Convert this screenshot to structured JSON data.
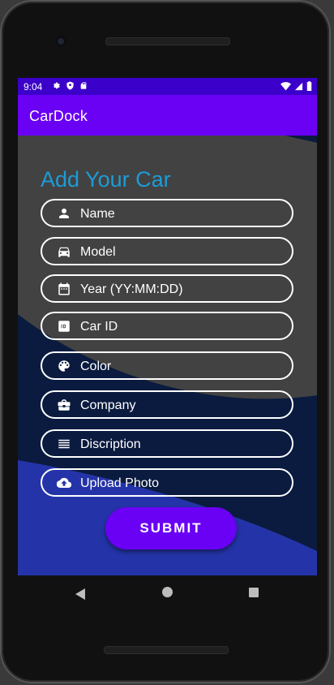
{
  "status_bar": {
    "time": "9:04",
    "left_icons": [
      "gear-icon",
      "shield-icon",
      "sd-card-icon"
    ],
    "right_icons": [
      "wifi-icon",
      "signal-icon",
      "battery-icon"
    ]
  },
  "app_bar": {
    "title": "CarDock"
  },
  "form": {
    "title": "Add Your Car",
    "fields": [
      {
        "label": "Name",
        "icon": "person-icon"
      },
      {
        "label": "Model",
        "icon": "car-icon"
      },
      {
        "label": "Year (YY:MM:DD)",
        "icon": "calendar-icon"
      },
      {
        "label": "Car ID",
        "icon": "id-badge-icon"
      },
      {
        "label": "Color",
        "icon": "palette-icon"
      },
      {
        "label": "Company",
        "icon": "briefcase-icon"
      },
      {
        "label": "Discription",
        "icon": "list-icon"
      },
      {
        "label": "Upload Photo",
        "icon": "cloud-upload-icon"
      }
    ],
    "submit_label": "SUBMIT"
  },
  "colors": {
    "status_bar": "#3b00c9",
    "app_bar": "#6a00f4",
    "title_text": "#1e9bd6",
    "background": "#424242",
    "wave_dark": "#0b1b3f",
    "wave_blue": "#2434a8",
    "submit_button": "#6a00f4"
  },
  "nav_bar": {
    "buttons": [
      "back-icon",
      "home-icon",
      "recents-icon"
    ]
  }
}
